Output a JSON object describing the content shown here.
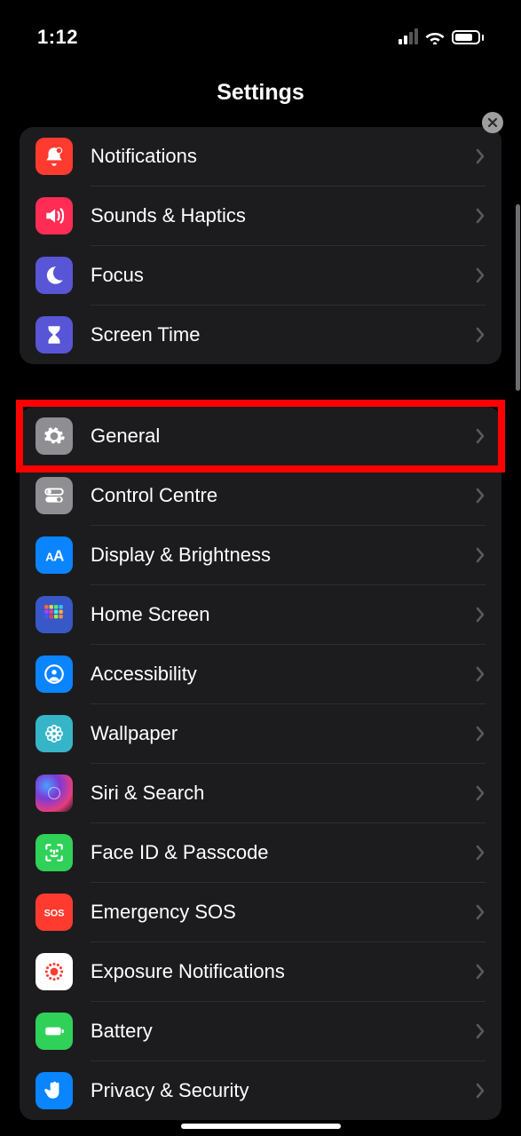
{
  "status": {
    "time": "1:12"
  },
  "page": {
    "title": "Settings"
  },
  "highlighted_row_id": "general",
  "groups": [
    {
      "items": [
        {
          "id": "notifications",
          "label": "Notifications",
          "icon": "bell-badge-icon",
          "bg": "#ff3b30"
        },
        {
          "id": "sounds",
          "label": "Sounds & Haptics",
          "icon": "speaker-icon",
          "bg": "#ff2d55"
        },
        {
          "id": "focus",
          "label": "Focus",
          "icon": "moon-icon",
          "bg": "#5856d6"
        },
        {
          "id": "screentime",
          "label": "Screen Time",
          "icon": "hourglass-icon",
          "bg": "#5856d6"
        }
      ]
    },
    {
      "items": [
        {
          "id": "general",
          "label": "General",
          "icon": "gear-icon",
          "bg": "#8e8e93"
        },
        {
          "id": "controlcentre",
          "label": "Control Centre",
          "icon": "switches-icon",
          "bg": "#8e8e93"
        },
        {
          "id": "display",
          "label": "Display & Brightness",
          "icon": "aa-icon",
          "bg": "#0a84ff"
        },
        {
          "id": "homescreen",
          "label": "Home Screen",
          "icon": "apps-grid-icon",
          "bg": "#3858c7"
        },
        {
          "id": "accessibility",
          "label": "Accessibility",
          "icon": "person-circle-icon",
          "bg": "#0a84ff"
        },
        {
          "id": "wallpaper",
          "label": "Wallpaper",
          "icon": "flower-icon",
          "bg": "#36b5c9"
        },
        {
          "id": "siri",
          "label": "Siri & Search",
          "icon": "siri-icon",
          "bg": "siri"
        },
        {
          "id": "faceid",
          "label": "Face ID & Passcode",
          "icon": "faceid-icon",
          "bg": "#30d158"
        },
        {
          "id": "sos",
          "label": "Emergency SOS",
          "icon": "sos-icon",
          "bg": "#ff3b30"
        },
        {
          "id": "exposure",
          "label": "Exposure Notifications",
          "icon": "exposure-icon",
          "bg": "#ffffff",
          "fg": "#ff3b30"
        },
        {
          "id": "battery",
          "label": "Battery",
          "icon": "battery-icon",
          "bg": "#30d158"
        },
        {
          "id": "privacy",
          "label": "Privacy & Security",
          "icon": "hand-icon",
          "bg": "#0a84ff"
        }
      ]
    }
  ]
}
